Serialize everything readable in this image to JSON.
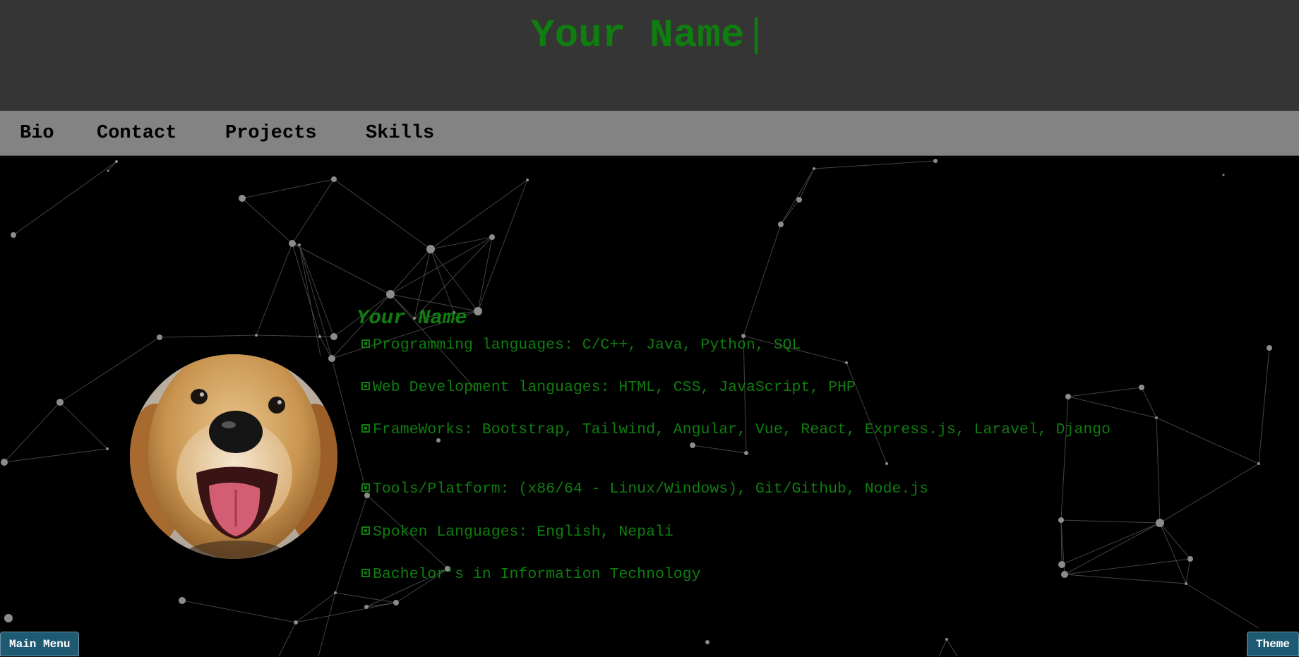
{
  "header": {
    "title": "Your Name",
    "cursor": "|"
  },
  "nav": {
    "items": [
      {
        "label": "Bio"
      },
      {
        "label": "Contact"
      },
      {
        "label": "Projects"
      },
      {
        "label": "Skills"
      }
    ]
  },
  "profile": {
    "name": "Your Name",
    "avatar_icon": "dog-photo",
    "skills": [
      "Programming languages: C/C++, Java, Python, SQL",
      "Web Development languages: HTML, CSS, JavaScript, PHP",
      "FrameWorks: Bootstrap, Tailwind, Angular, Vue, React, Express.js, Laravel, Django",
      "Tools/Platform: (x86/64 - Linux/Windows), Git/Github, Node.js",
      "Spoken Languages: English, Nepali",
      "Bachelor's in Information Technology"
    ]
  },
  "buttons": {
    "main_menu": "Main Menu",
    "theme": "Theme"
  },
  "colors": {
    "accent_green": "#0f7d0f",
    "header_bg": "#353535",
    "nav_bg": "#838383",
    "button_bg": "#1f5a73"
  }
}
